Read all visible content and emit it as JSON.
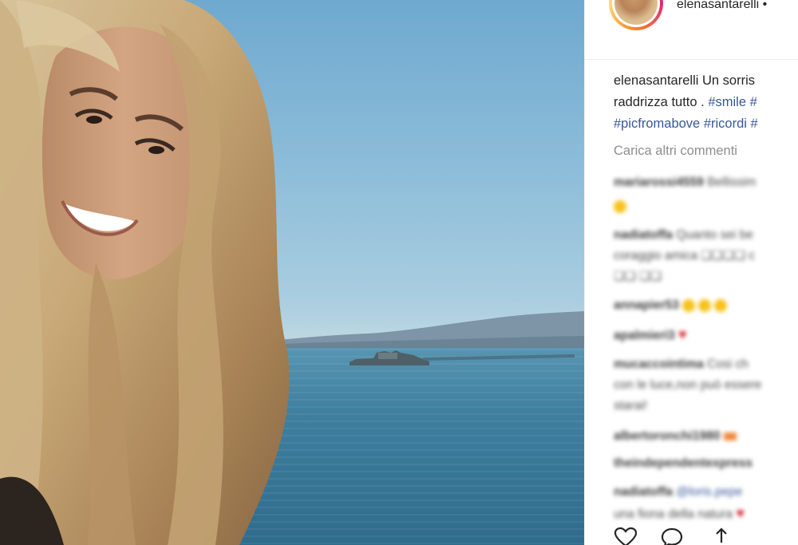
{
  "post": {
    "username": "elenasantarelli",
    "username_suffix": " •"
  },
  "caption": {
    "username": "elenasantarelli",
    "line1_text": " Un sorris",
    "line2_text": "raddrizza tutto . ",
    "line2_tags": [
      "#smile",
      "#"
    ],
    "line3_tags": [
      "#picfromabove",
      "#ricordi",
      "#"
    ]
  },
  "load_more_label": "Carica altri commenti",
  "comments": [
    {
      "user": "mariarossi4559",
      "text": " Bellissim"
    },
    {
      "user": "",
      "text": "",
      "emoji": "yellow-face"
    },
    {
      "user": "nadiatoffa",
      "text": " Quanto sei be"
    },
    {
      "user": "",
      "text": "coraggio amica ❏❏❏❏ c"
    },
    {
      "user": "",
      "text": "❏❏ ❏❏"
    },
    {
      "user": "annapier53",
      "text": " ",
      "emoji": "three-faces"
    },
    {
      "user": "apalmieri3",
      "text": " ",
      "emoji": "heart"
    },
    {
      "user": "mucaccointima",
      "text": " Cosi ch"
    },
    {
      "user": "",
      "text": "con le luce,non può essere"
    },
    {
      "user": "",
      "text": "starai!"
    },
    {
      "user": "albertoronchi1980",
      "text": " ",
      "emoji": "orange"
    },
    {
      "user": "theindependentexpress",
      "text": ""
    },
    {
      "user": "nadiatoffa",
      "text": " ",
      "mention": "@loris.pepe"
    },
    {
      "user": "",
      "text": "una fiona della natura ",
      "emoji": "heart"
    }
  ],
  "actions": {
    "like_icon": "heart-outline-icon",
    "comment_icon": "comment-bubble-icon",
    "share_icon": "share-icon"
  },
  "colors": {
    "hashtag": "#385898",
    "muted": "#8e8e8e",
    "text": "#262626"
  }
}
